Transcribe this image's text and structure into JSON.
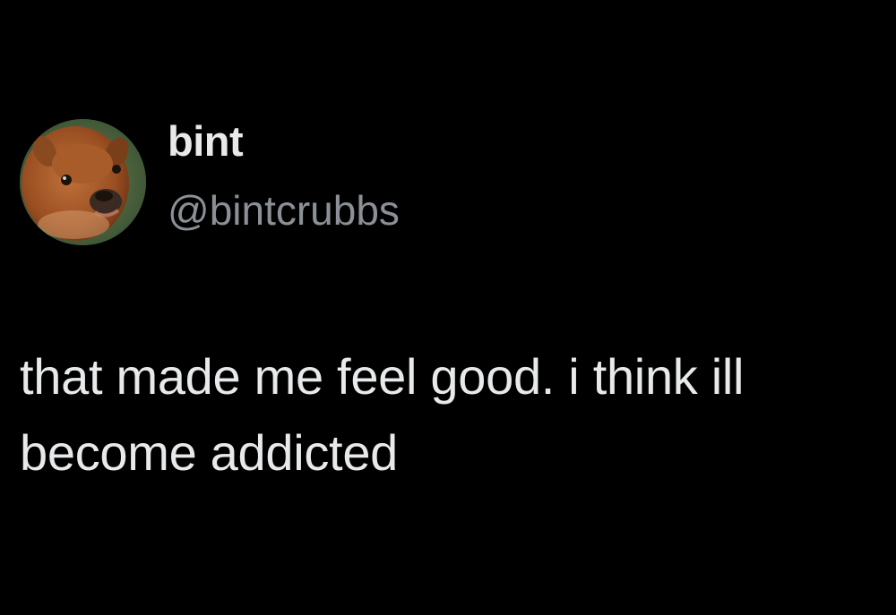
{
  "tweet": {
    "author": {
      "display_name": "bint",
      "handle": "@bintcrubbs",
      "avatar_icon": "baby-deer-avatar"
    },
    "text": "that made me feel good. i think ill become addicted"
  },
  "colors": {
    "background": "#000000",
    "primary_text": "#e7e9ea",
    "secondary_text": "#8b9096"
  }
}
